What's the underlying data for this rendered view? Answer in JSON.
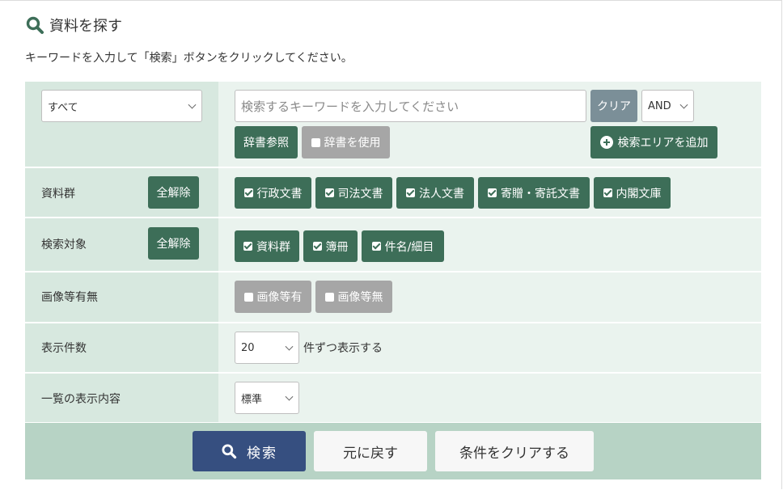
{
  "header": {
    "title": "資料を探す",
    "instruction": "キーワードを入力して「検索」ボタンをクリックしてください。"
  },
  "search": {
    "scope_select": "すべて",
    "keyword_placeholder": "検索するキーワードを入力してください",
    "clear_label": "クリア",
    "operator_select": "AND",
    "dictionary_label": "辞書参照",
    "use_dictionary_label": "辞書を使用",
    "add_area_label": "検索エリアを追加"
  },
  "collections": {
    "label": "資料群",
    "clear_all_label": "全解除",
    "options": [
      {
        "label": "行政文書",
        "checked": true
      },
      {
        "label": "司法文書",
        "checked": true
      },
      {
        "label": "法人文書",
        "checked": true
      },
      {
        "label": "寄贈・寄託文書",
        "checked": true
      },
      {
        "label": "内閣文庫",
        "checked": true
      }
    ]
  },
  "targets": {
    "label": "検索対象",
    "clear_all_label": "全解除",
    "options": [
      {
        "label": "資料群",
        "checked": true
      },
      {
        "label": "簿冊",
        "checked": true
      },
      {
        "label": "件名/細目",
        "checked": true
      }
    ]
  },
  "images": {
    "label": "画像等有無",
    "options": [
      {
        "label": "画像等有",
        "checked": false
      },
      {
        "label": "画像等無",
        "checked": false
      }
    ]
  },
  "count": {
    "label": "表示件数",
    "select": "20",
    "suffix": "件ずつ表示する"
  },
  "display": {
    "label": "一覧の表示内容",
    "select": "標準"
  },
  "actions": {
    "search_label": "検索",
    "reset_label": "元に戻す",
    "clear_conditions_label": "条件をクリアする"
  },
  "colors": {
    "primary_green": "#3d6e58",
    "label_bg": "#d7e8df",
    "content_bg": "#eaf3ee",
    "footer_bg": "#b7d3c5",
    "search_button": "#364f80",
    "disabled": "#a6a6a6"
  }
}
